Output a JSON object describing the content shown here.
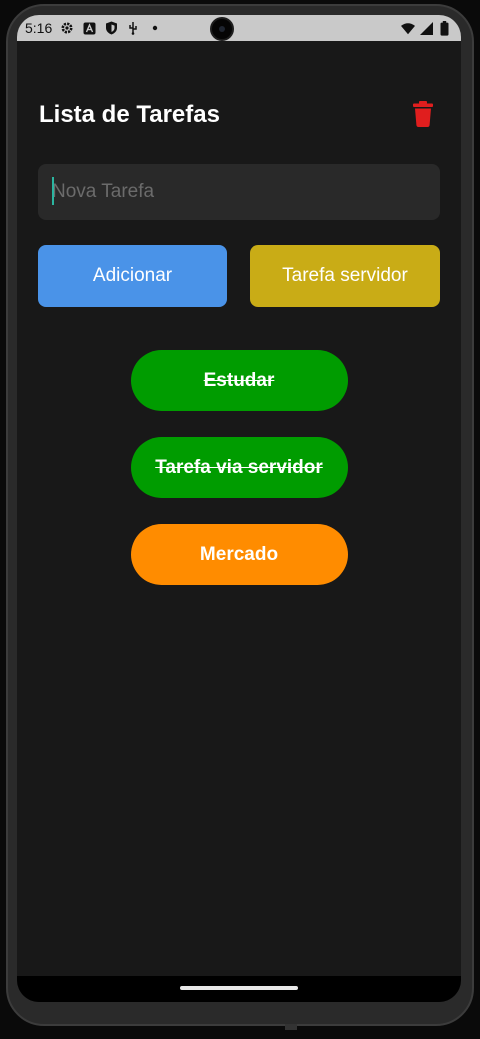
{
  "status_bar": {
    "time": "5:16",
    "icons_left": [
      "gear-icon",
      "font-app-icon",
      "shield-icon",
      "usb-debug-icon",
      "dot-icon"
    ],
    "icons_right": [
      "wifi-icon",
      "signal-icon",
      "battery-icon"
    ]
  },
  "header": {
    "title": "Lista de Tarefas",
    "clear_icon": "trash-icon"
  },
  "input": {
    "placeholder": "Nova Tarefa",
    "value": ""
  },
  "actions": {
    "add_label": "Adicionar",
    "server_label": "Tarefa servidor"
  },
  "tasks": [
    {
      "label": "Estudar",
      "done": true,
      "color": "#009c00"
    },
    {
      "label": "Tarefa via servidor",
      "done": true,
      "color": "#009c00"
    },
    {
      "label": "Mercado",
      "done": false,
      "color": "#ff8c00"
    }
  ],
  "colors": {
    "background": "#181818",
    "add_button": "#4a93e8",
    "server_button": "#c9ac16",
    "trash": "#e01e1e",
    "done_task": "#009c00",
    "pending_task": "#ff8c00"
  }
}
